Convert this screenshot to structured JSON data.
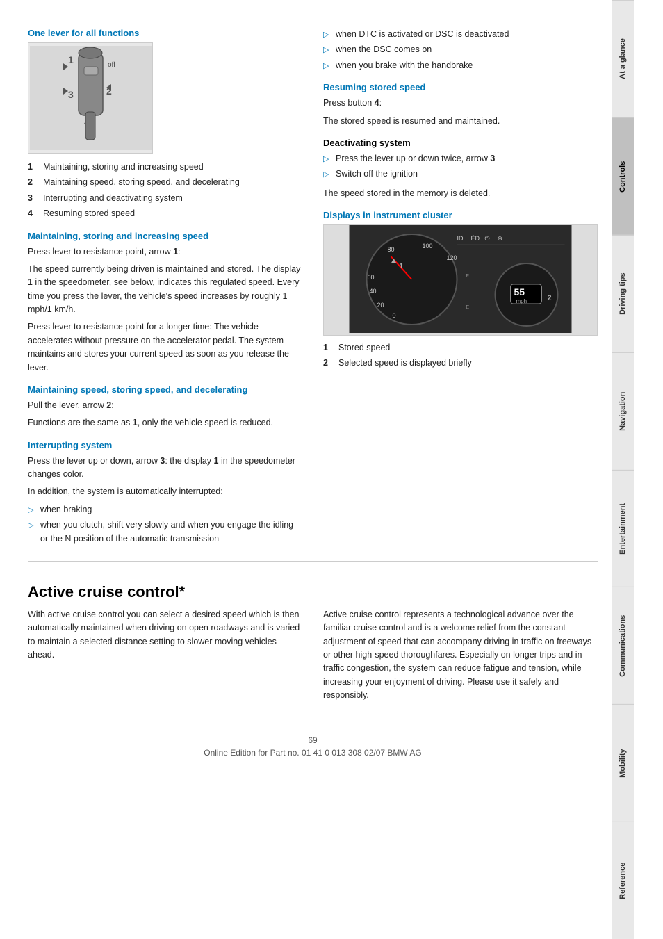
{
  "sidebar": {
    "tabs": [
      {
        "label": "At a glance",
        "active": false
      },
      {
        "label": "Controls",
        "active": true
      },
      {
        "label": "Driving tips",
        "active": false
      },
      {
        "label": "Navigation",
        "active": false
      },
      {
        "label": "Entertainment",
        "active": false
      },
      {
        "label": "Communications",
        "active": false
      },
      {
        "label": "Mobility",
        "active": false
      },
      {
        "label": "Reference",
        "active": false
      }
    ]
  },
  "left_column": {
    "section1_heading": "One lever for all functions",
    "numbered_items": [
      {
        "num": "1",
        "text": "Maintaining, storing and increasing speed"
      },
      {
        "num": "2",
        "text": "Maintaining speed, storing speed, and decelerating"
      },
      {
        "num": "3",
        "text": "Interrupting and deactivating system"
      },
      {
        "num": "4",
        "text": "Resuming stored speed"
      }
    ],
    "section2_heading": "Maintaining, storing and increasing speed",
    "section2_p1": "Press lever to resistance point, arrow 1:",
    "section2_p2": "The speed currently being driven is maintained and stored. The display 1 in the speedometer, see below, indicates this regulated speed. Every time you press the lever, the vehicle's speed increases by roughly 1 mph/1 km/h.",
    "section2_p3": "Press lever to resistance point for a longer time: The vehicle accelerates without pressure on the accelerator pedal. The system maintains and stores your current speed as soon as you release the lever.",
    "section3_heading": "Maintaining speed, storing speed, and decelerating",
    "section3_p1": "Pull the lever, arrow 2:",
    "section3_p2": "Functions are the same as 1, only the vehicle speed is reduced.",
    "section4_heading": "Interrupting system",
    "section4_p1": "Press the lever up or down, arrow 3: the display 1 in the speedometer changes color.",
    "section4_p2": "In addition, the system is automatically interrupted:",
    "section4_bullets": [
      "when braking",
      "when you clutch, shift very slowly and when you engage the idling or the N position of the automatic transmission"
    ]
  },
  "right_column": {
    "bullets_top": [
      "when DTC is activated or DSC is deactivated",
      "when the DSC comes on",
      "when you brake with the handbrake"
    ],
    "section5_heading": "Resuming stored speed",
    "section5_p1": "Press button 4:",
    "section5_p2": "The stored speed is resumed and maintained.",
    "section6_heading": "Deactivating system",
    "section6_bullets": [
      "Press the lever up or down twice, arrow 3",
      "Switch off the ignition"
    ],
    "section6_p1": "The speed stored in the memory is deleted.",
    "section7_heading": "Displays in instrument cluster",
    "instrument_labels": [
      {
        "num": "1",
        "text": "Stored speed"
      },
      {
        "num": "2",
        "text": "Selected speed is displayed briefly"
      }
    ]
  },
  "active_cruise_section": {
    "heading": "Active cruise control*",
    "paragraph1": "With active cruise control you can select a desired speed which is then automatically maintained when driving on open roadways and is varied to maintain a selected distance setting to slower moving vehicles ahead.",
    "paragraph2": "Active cruise control represents a technological advance over the familiar cruise control and is a welcome relief from the constant adjustment of speed that can accompany driving in traffic on freeways or other high-speed thoroughfares. Especially on longer trips and in traffic congestion, the system can reduce fatigue and tension, while increasing your enjoyment of driving. Please use it safely and responsibly."
  },
  "footer": {
    "page_number": "69",
    "footer_text": "Online Edition for Part no. 01 41 0 013 308 02/07 BMW AG"
  }
}
